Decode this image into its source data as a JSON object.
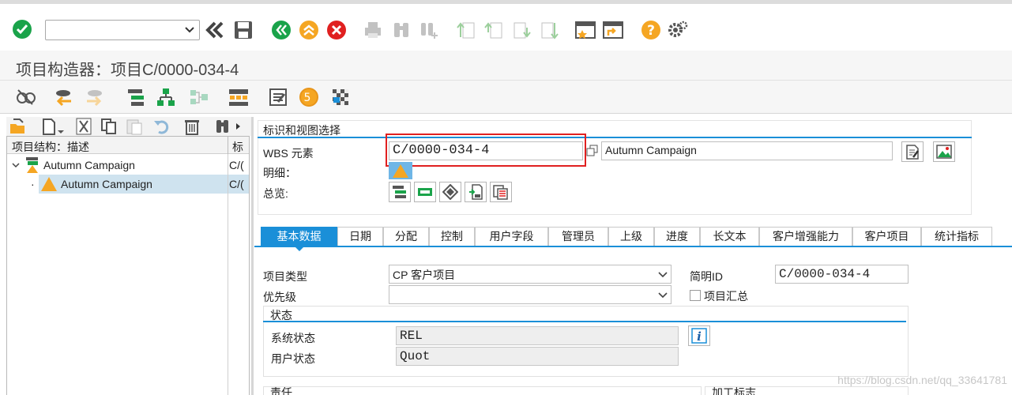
{
  "toolbar": {
    "command_field_value": "",
    "icons": [
      "check-icon",
      "command-dropdown",
      "back-double-icon",
      "save-icon",
      "back-icon",
      "exit-icon",
      "cancel-icon",
      "print-icon",
      "find-icon",
      "find-next-icon",
      "first-page-icon",
      "previous-page-icon",
      "next-page-icon",
      "last-page-icon",
      "new-window-icon",
      "shortcut-icon",
      "help-icon",
      "settings-icon"
    ]
  },
  "title": "项目构造器：项目C/0000-034-4",
  "left": {
    "header_col1": "项目结构：描述",
    "header_col2": "标",
    "tree": [
      {
        "label": "Autumn Campaign",
        "col2": "C/(",
        "level": 0
      },
      {
        "label": "Autumn Campaign",
        "col2": "C/(",
        "level": 1,
        "selected": true
      }
    ]
  },
  "ident": {
    "section_title": "标识和视图选择",
    "wbs_label": "WBS 元素",
    "wbs_value": "C/0000-034-4",
    "wbs_desc": "Autumn Campaign",
    "detail_label": "明细：",
    "overview_label": "总览:"
  },
  "tabs": [
    "基本数据",
    "日期",
    "分配",
    "控制",
    "用户字段",
    "管理员",
    "上级",
    "进度",
    "长文本",
    "客户增强能力",
    "客户项目",
    "统计指标"
  ],
  "basic": {
    "proj_type_label": "项目类型",
    "proj_type_value": "CP 客户项目",
    "short_id_label": "简明ID",
    "short_id_value": "C/0000-034-4",
    "priority_label": "优先级",
    "priority_value": "",
    "summary_label": "项目汇总",
    "status_title": "状态",
    "sys_status_label": "系统状态",
    "sys_status_value": "REL",
    "user_status_label": "用户状态",
    "user_status_value": "Quot",
    "resp_title": "责任",
    "op_title": "加工标志"
  },
  "watermark": "https://blog.csdn.net/qq_33641781",
  "colors": {
    "accent": "#1a8fd8",
    "highlight": "#e02020",
    "green": "#1aa34a",
    "orange": "#f5a623"
  }
}
